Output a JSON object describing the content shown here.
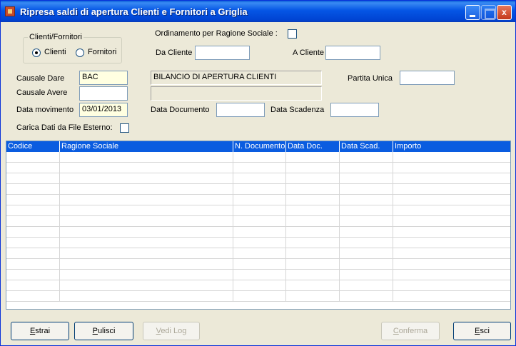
{
  "window": {
    "title": "Ripresa saldi di apertura Clienti e Fornitori a Griglia"
  },
  "titlebar_buttons": {
    "minimize": "_",
    "maximize": "",
    "close": "x"
  },
  "group": {
    "title": "Clienti/Fornitori",
    "option_clienti": "Clienti",
    "option_fornitori": "Fornitori",
    "selected": "Clienti"
  },
  "ordering": {
    "label": "Ordinamento per Ragione Sociale :",
    "checked": false
  },
  "da_cliente": {
    "label": "Da Cliente",
    "value": ""
  },
  "a_cliente": {
    "label": "A Cliente",
    "value": ""
  },
  "causale_dare": {
    "label": "Causale Dare",
    "value": "BAC",
    "description": "BILANCIO DI APERTURA CLIENTI"
  },
  "causale_avere": {
    "label": "Causale Avere",
    "value": "",
    "description": ""
  },
  "partita_unica": {
    "label": "Partita Unica",
    "value": ""
  },
  "data_movimento": {
    "label": "Data movimento",
    "value": "03/01/2013"
  },
  "data_documento": {
    "label": "Data Documento",
    "value": ""
  },
  "data_scadenza": {
    "label": "Data Scadenza",
    "value": ""
  },
  "carica_dati": {
    "label": "Carica Dati da File Esterno:",
    "checked": false
  },
  "grid": {
    "columns": [
      "Codice",
      "Ragione Sociale",
      "N. Documento",
      "Data Doc.",
      "Data Scad.",
      "Importo"
    ],
    "row_count": 14
  },
  "buttons": {
    "estrai": {
      "pre": "",
      "ul": "E",
      "post": "strai"
    },
    "pulisci": {
      "pre": "",
      "ul": "P",
      "post": "ulisci"
    },
    "vedi_log": {
      "pre": "",
      "ul": "V",
      "post": "edi Log"
    },
    "conferma": {
      "pre": "",
      "ul": "C",
      "post": "onferma"
    },
    "esci": {
      "pre": "",
      "ul": "E",
      "post": "sci"
    }
  }
}
